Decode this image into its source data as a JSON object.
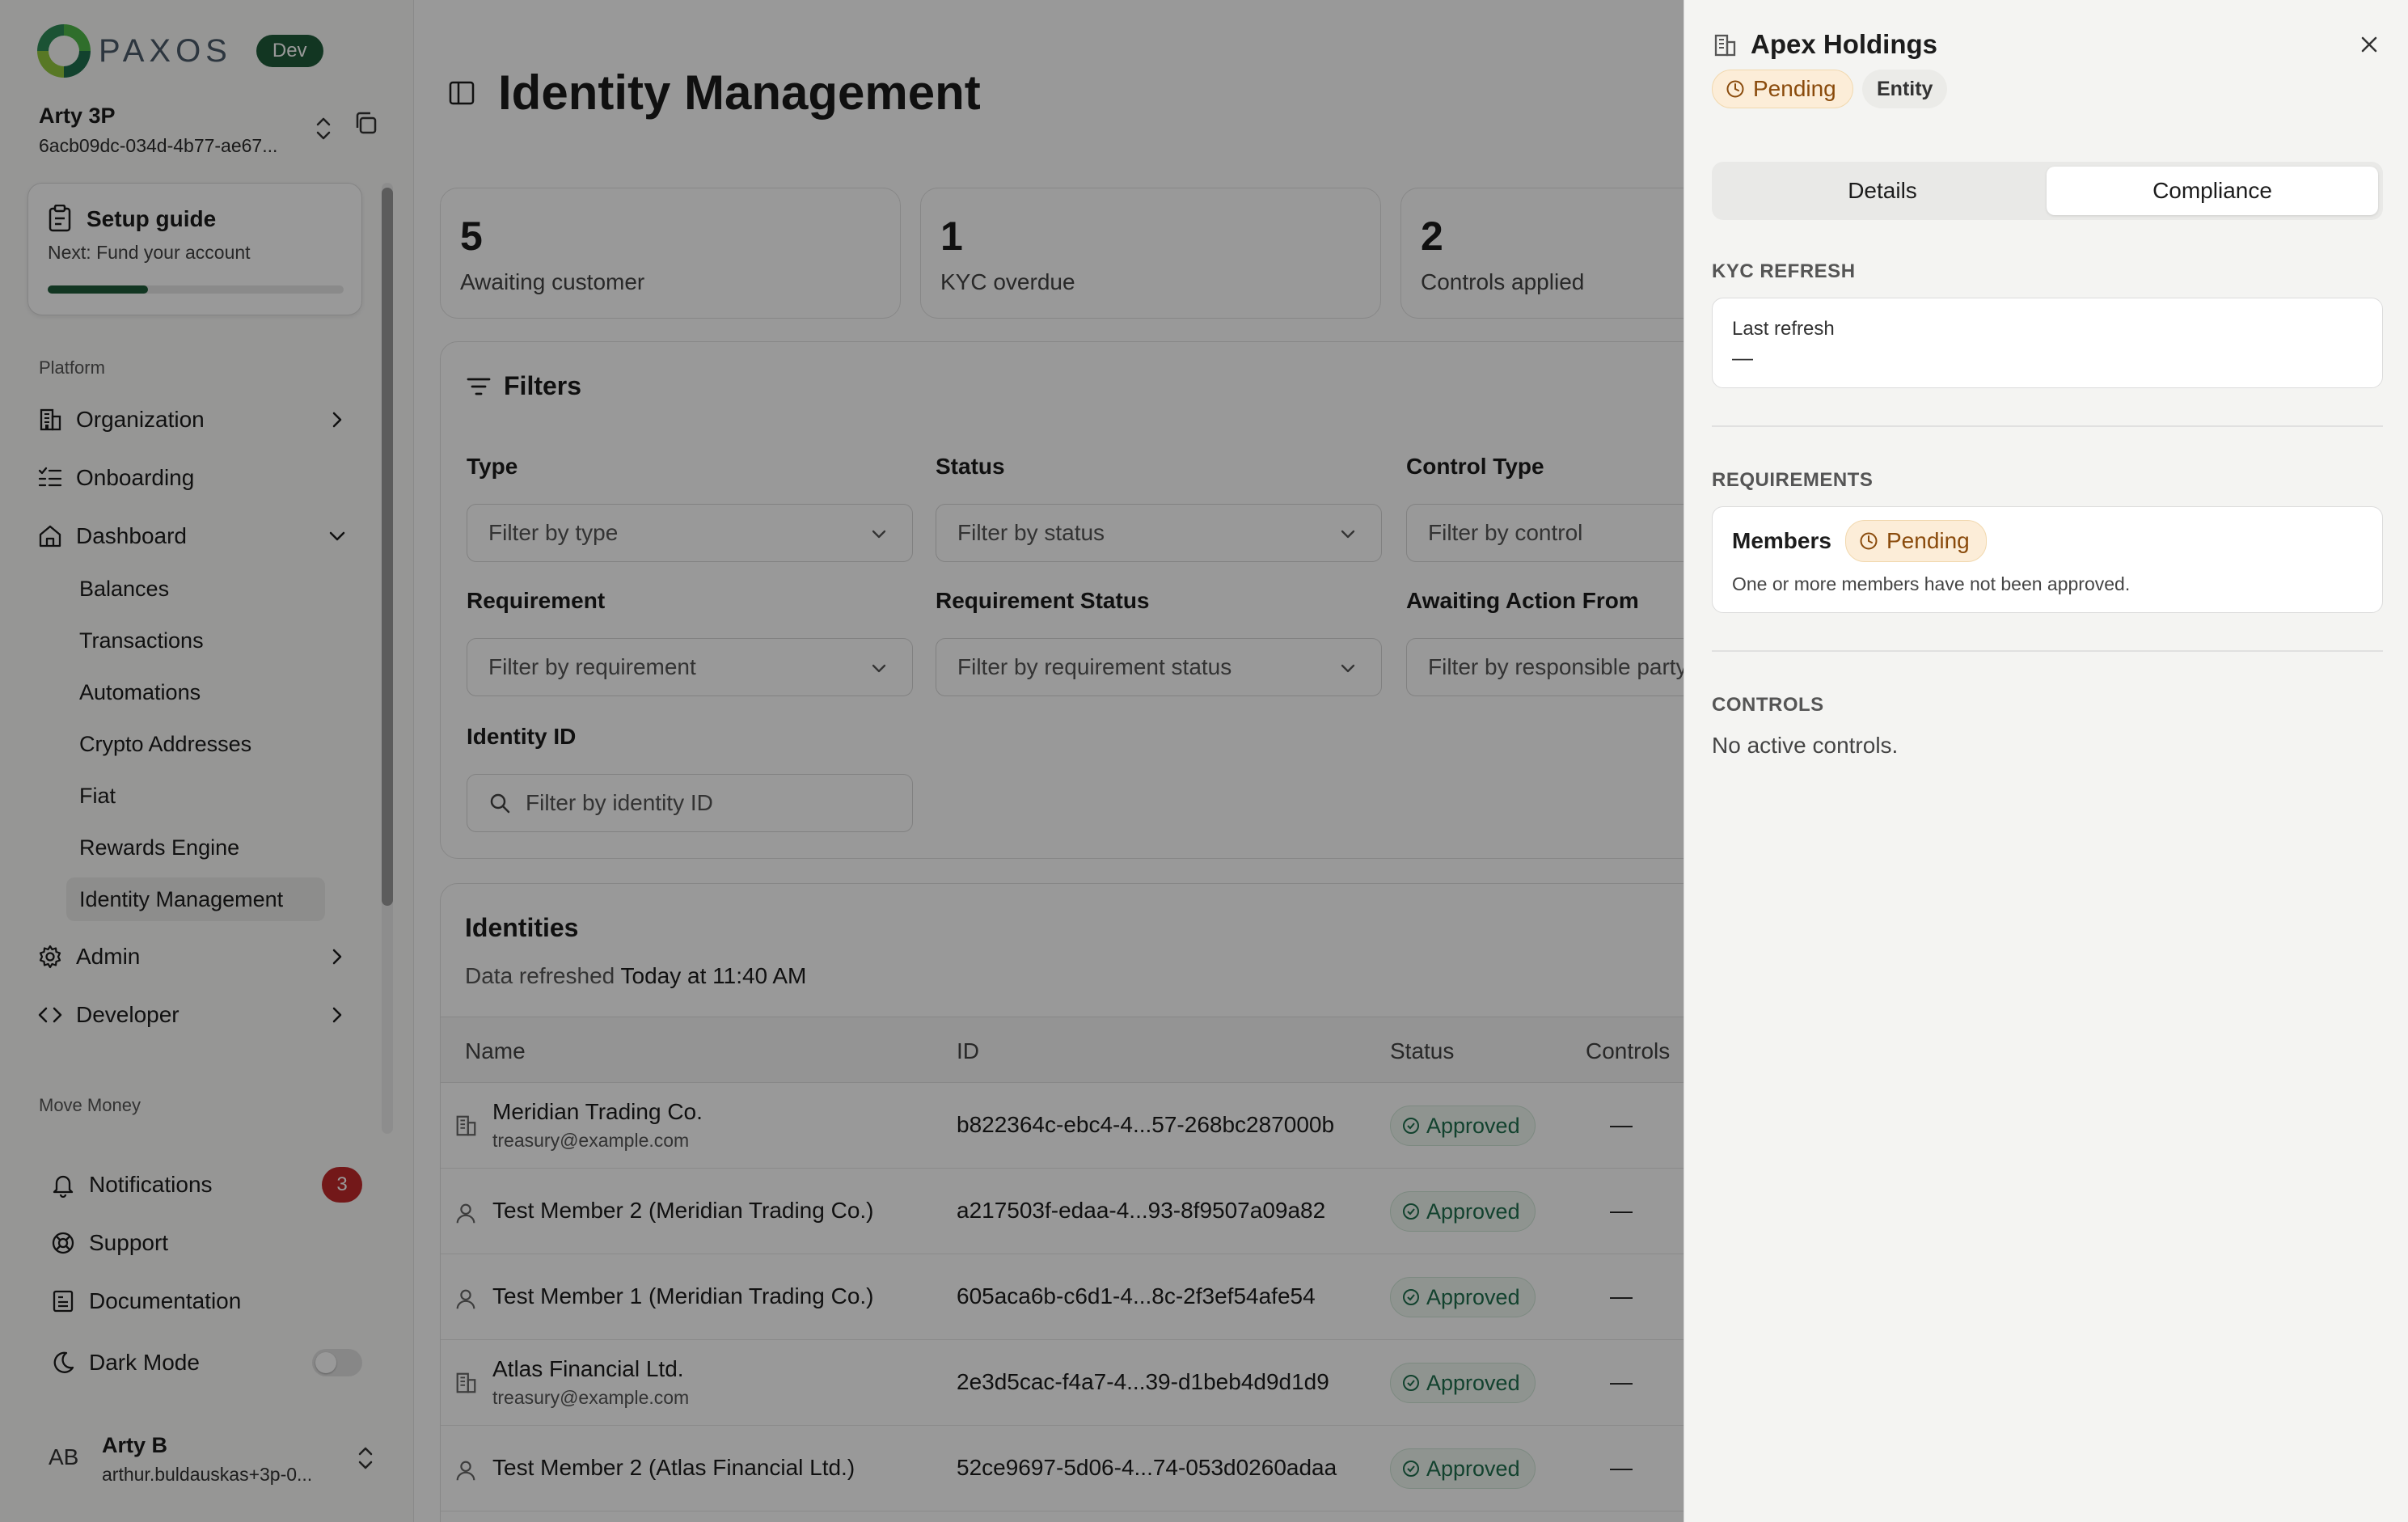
{
  "brand": {
    "logo_text": "PAXOS",
    "env_badge": "Dev"
  },
  "account": {
    "name": "Arty 3P",
    "id": "6acb09dc-034d-4b77-ae67..."
  },
  "setup_guide": {
    "title": "Setup guide",
    "subtitle": "Next: Fund your account",
    "progress": 0.34
  },
  "sidebar": {
    "platform_label": "Platform",
    "items": [
      {
        "label": "Organization"
      },
      {
        "label": "Onboarding"
      },
      {
        "label": "Dashboard"
      }
    ],
    "dashboard_sub": [
      {
        "label": "Balances"
      },
      {
        "label": "Transactions"
      },
      {
        "label": "Automations"
      },
      {
        "label": "Crypto Addresses"
      },
      {
        "label": "Fiat"
      },
      {
        "label": "Rewards Engine"
      },
      {
        "label": "Identity Management"
      }
    ],
    "admin": "Admin",
    "developer": "Developer",
    "move_money_label": "Move Money",
    "notifications": "Notifications",
    "notifications_count": "3",
    "support": "Support",
    "documentation": "Documentation",
    "dark_mode": "Dark Mode"
  },
  "user": {
    "initials": "AB",
    "name": "Arty B",
    "email": "arthur.buldauskas+3p-0..."
  },
  "main": {
    "title": "Identity Management",
    "stats": [
      {
        "value": "5",
        "label": "Awaiting customer"
      },
      {
        "value": "1",
        "label": "KYC overdue"
      },
      {
        "value": "2",
        "label": "Controls applied"
      }
    ],
    "filters": {
      "title": "Filters",
      "type_label": "Type",
      "type_placeholder": "Filter by type",
      "status_label": "Status",
      "status_placeholder": "Filter by status",
      "control_label": "Control Type",
      "control_placeholder": "Filter by control",
      "requirement_label": "Requirement",
      "requirement_placeholder": "Filter by requirement",
      "req_status_label": "Requirement Status",
      "req_status_placeholder": "Filter by requirement status",
      "awaiting_label": "Awaiting Action From",
      "awaiting_placeholder": "Filter by responsible party",
      "identity_label": "Identity ID",
      "identity_placeholder": "Filter by identity ID"
    },
    "identities": {
      "title": "Identities",
      "refreshed_prefix": "Data refreshed",
      "refreshed_time": "Today at 11:40 AM",
      "columns": [
        "Name",
        "ID",
        "Status",
        "Controls"
      ],
      "rows": [
        {
          "name": "Meridian Trading Co.",
          "email": "treasury@example.com",
          "id": "b822364c-ebc4-4...57-268bc287000b",
          "status": "Approved",
          "controls": "—",
          "kind": "entity"
        },
        {
          "name": "Test Member 2 (Meridian Trading Co.)",
          "email": "",
          "id": "a217503f-edaa-4...93-8f9507a09a82",
          "status": "Approved",
          "controls": "—",
          "kind": "person"
        },
        {
          "name": "Test Member 1 (Meridian Trading Co.)",
          "email": "",
          "id": "605aca6b-c6d1-4...8c-2f3ef54afe54",
          "status": "Approved",
          "controls": "—",
          "kind": "person"
        },
        {
          "name": "Atlas Financial Ltd.",
          "email": "treasury@example.com",
          "id": "2e3d5cac-f4a7-4...39-d1beb4d9d1d9",
          "status": "Approved",
          "controls": "—",
          "kind": "entity"
        },
        {
          "name": "Test Member 2 (Atlas Financial Ltd.)",
          "email": "",
          "id": "52ce9697-5d06-4...74-053d0260adaa",
          "status": "Approved",
          "controls": "—",
          "kind": "person"
        }
      ]
    }
  },
  "drawer": {
    "title": "Apex Holdings",
    "status": "Pending",
    "type": "Entity",
    "tabs": [
      {
        "label": "Details"
      },
      {
        "label": "Compliance"
      }
    ],
    "active_tab": "Compliance",
    "kyc": {
      "section": "KYC REFRESH",
      "label": "Last refresh",
      "value": "—"
    },
    "requirements": {
      "section": "REQUIREMENTS",
      "name": "Members",
      "status": "Pending",
      "description": "One or more members have not been approved."
    },
    "controls": {
      "section": "CONTROLS",
      "empty": "No active controls."
    }
  },
  "colors": {
    "brand_green": "#1f5a3a",
    "approved": "#1f6e4d",
    "pending": "#8a4b0c",
    "pending_bg": "#fcedd8",
    "notif_red": "#c0292b"
  }
}
